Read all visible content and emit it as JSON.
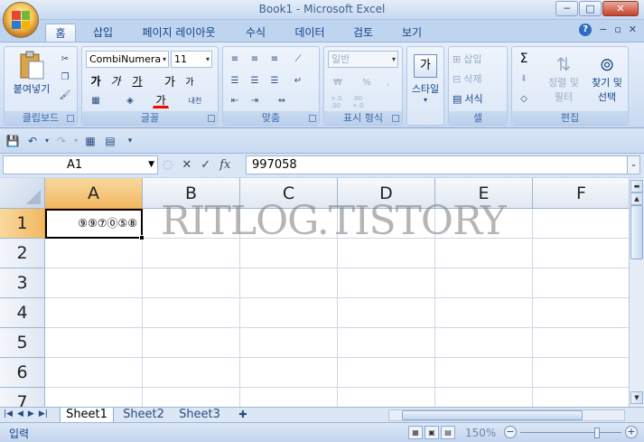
{
  "window": {
    "title": "Book1 - Microsoft Excel",
    "min_label": "─",
    "max_label": "□",
    "close_label": "✕"
  },
  "ribbon_tabs": [
    "홈",
    "삽입",
    "페이지 레이아웃",
    "수식",
    "데이터",
    "검토",
    "보기"
  ],
  "clipboard": {
    "paste_label": "붙여넣기",
    "group_label": "클립보드"
  },
  "font": {
    "font_name": "CombiNumera",
    "font_size": "11",
    "bold": "가",
    "italic": "가",
    "underline": "가",
    "grow": "가",
    "shrink": "가",
    "color_a": "가",
    "phonetic": "내천",
    "group_label": "글꼴"
  },
  "alignment": {
    "group_label": "맞춤"
  },
  "number": {
    "format": "일반",
    "currency": "₩",
    "percent": "%",
    "comma": ",",
    "inc_decimal": "+.0 .00",
    "dec_decimal": ".00 ÷.0",
    "group_label": "표시 형식"
  },
  "styles": {
    "label": "스타일",
    "icon_text": "가"
  },
  "cells": {
    "insert": "삽입",
    "delete": "삭제",
    "format": "서식",
    "group_label": "셀"
  },
  "editing": {
    "sigma": "Σ",
    "sort": "정렬 및\n필터",
    "sort_line1": "정렬 및",
    "sort_line2": "필터",
    "find_line1": "찾기 및",
    "find_line2": "선택",
    "group_label": "편집"
  },
  "formula_bar": {
    "name_box": "A1",
    "fx": "fx",
    "cancel": "✕",
    "enter": "✓",
    "value": "997058"
  },
  "grid": {
    "columns": [
      "A",
      "B",
      "C",
      "D",
      "E",
      "F"
    ],
    "rows": [
      "1",
      "2",
      "3",
      "4",
      "5",
      "6",
      "7"
    ],
    "cell_a1": "⑨⑨⑦⓪⑤⑧",
    "watermark": "RITLOG.TISTORY"
  },
  "sheets": [
    "Sheet1",
    "Sheet2",
    "Sheet3"
  ],
  "status": {
    "mode": "입력",
    "zoom": "150%"
  },
  "colors": {
    "ribbon_text": "#15428b",
    "selected_header": "#f1b860",
    "font_color_bar": "#ff0000"
  }
}
